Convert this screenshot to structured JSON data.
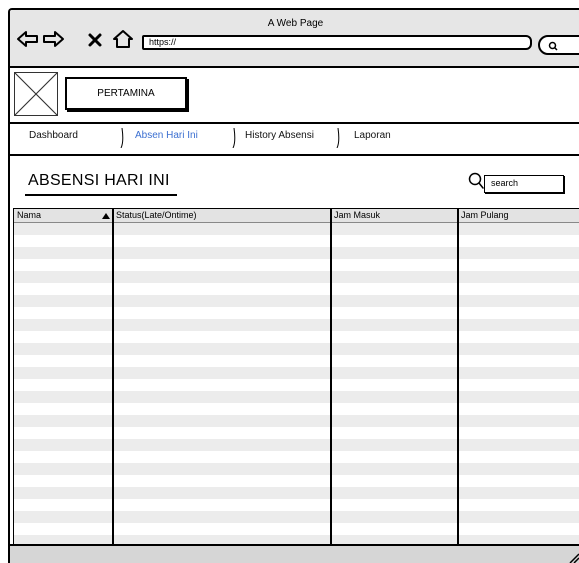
{
  "window": {
    "title": "A Web Page"
  },
  "browser": {
    "url": "https://"
  },
  "header": {
    "brand": "PERTAMINA"
  },
  "tabs": [
    {
      "label": "Dashboard",
      "active": false
    },
    {
      "label": "Absen Hari Ini",
      "active": true
    },
    {
      "label": "History Absensi",
      "active": false
    },
    {
      "label": "Laporan",
      "active": false
    }
  ],
  "main": {
    "title": "ABSENSI HARI INI",
    "search_text": "search"
  },
  "table": {
    "columns": [
      "Nama",
      "Status(Late/Ontime)",
      "Jam Masuk",
      "Jam Pulang"
    ],
    "sorted_column": "Nama"
  },
  "colors": {
    "active_tab": "#3b6fd1",
    "row_shade": "#ececec",
    "chrome": "#e6e6e6"
  }
}
